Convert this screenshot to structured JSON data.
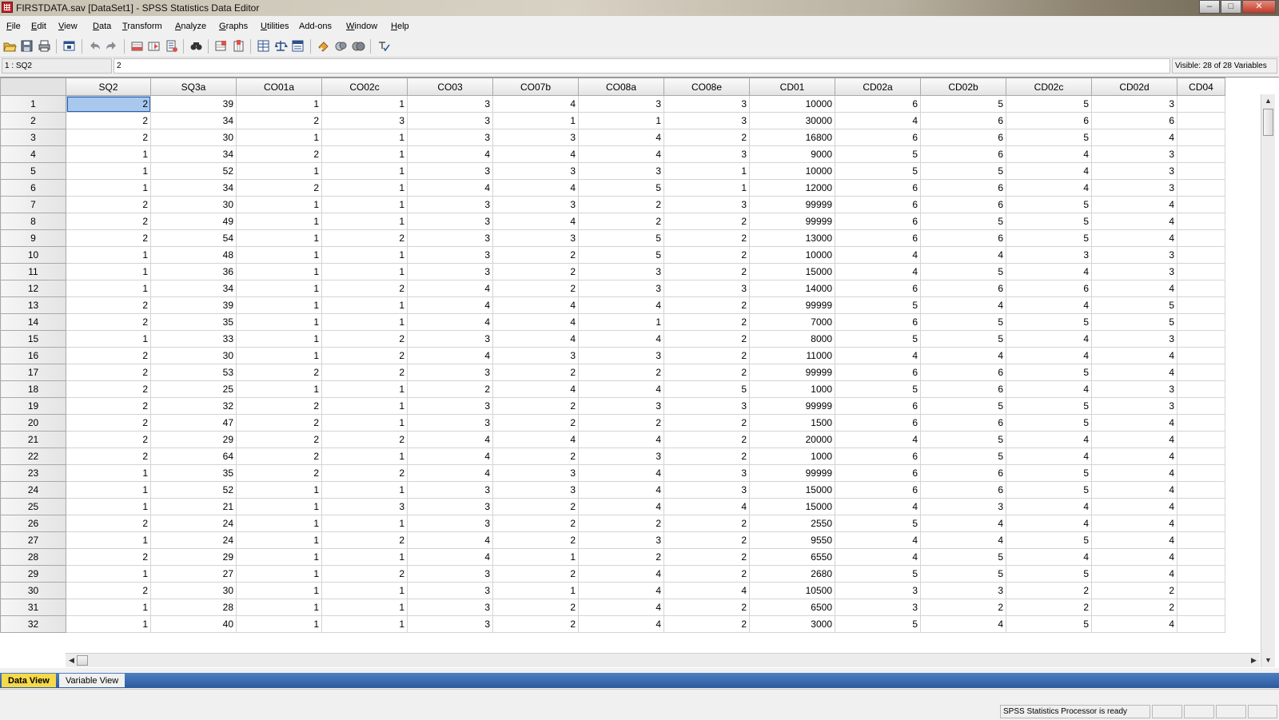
{
  "window": {
    "title": "FIRSTDATA.sav [DataSet1] - SPSS Statistics Data Editor",
    "minimize": "–",
    "maximize": "□",
    "close": "✕"
  },
  "menu": [
    {
      "u": "F",
      "rest": "ile"
    },
    {
      "u": "E",
      "rest": "dit"
    },
    {
      "u": "V",
      "rest": "iew"
    },
    {
      "u": "D",
      "rest": "ata"
    },
    {
      "u": "T",
      "rest": "ransform"
    },
    {
      "u": "A",
      "rest": "nalyze"
    },
    {
      "u": "G",
      "rest": "raphs"
    },
    {
      "u": "U",
      "rest": "tilities"
    },
    {
      "u": "",
      "rest": "Add-ons"
    },
    {
      "u": "W",
      "rest": "indow"
    },
    {
      "u": "H",
      "rest": "elp"
    }
  ],
  "toolbar_icons": [
    "open-icon",
    "save-icon",
    "print-icon",
    "dialog-recall-icon",
    "undo-icon",
    "redo-icon",
    "goto-case-icon",
    "goto-variable-icon",
    "variables-icon",
    "find-icon",
    "insert-cases-icon",
    "insert-variable-icon",
    "split-file-icon",
    "weight-cases-icon",
    "select-cases-icon",
    "value-labels-icon",
    "use-variable-sets-icon",
    "show-all-variables-icon",
    "spell-check-icon"
  ],
  "editor": {
    "cell_ref": "1 : SQ2",
    "cell_value": "2",
    "visible_variables": "Visible: 28 of 28 Variables"
  },
  "columns": [
    "SQ2",
    "SQ3a",
    "CO01a",
    "CO02c",
    "CO03",
    "CO07b",
    "CO08a",
    "CO08e",
    "CD01",
    "CD02a",
    "CD02b",
    "CD02c",
    "CD02d",
    "CD04"
  ],
  "rows": [
    [
      1,
      [
        2,
        39,
        1,
        1,
        3,
        4,
        3,
        3,
        10000,
        6,
        5,
        5,
        3
      ]
    ],
    [
      2,
      [
        2,
        34,
        2,
        3,
        3,
        1,
        1,
        3,
        30000,
        4,
        6,
        6,
        6
      ]
    ],
    [
      3,
      [
        2,
        30,
        1,
        1,
        3,
        3,
        4,
        2,
        16800,
        6,
        6,
        5,
        4
      ]
    ],
    [
      4,
      [
        1,
        34,
        2,
        1,
        4,
        4,
        4,
        3,
        9000,
        5,
        6,
        4,
        3
      ]
    ],
    [
      5,
      [
        1,
        52,
        1,
        1,
        3,
        3,
        3,
        1,
        10000,
        5,
        5,
        4,
        3
      ]
    ],
    [
      6,
      [
        1,
        34,
        2,
        1,
        4,
        4,
        5,
        1,
        12000,
        6,
        6,
        4,
        3
      ]
    ],
    [
      7,
      [
        2,
        30,
        1,
        1,
        3,
        3,
        2,
        3,
        99999,
        6,
        6,
        5,
        4
      ]
    ],
    [
      8,
      [
        2,
        49,
        1,
        1,
        3,
        4,
        2,
        2,
        99999,
        6,
        5,
        5,
        4
      ]
    ],
    [
      9,
      [
        2,
        54,
        1,
        2,
        3,
        3,
        5,
        2,
        13000,
        6,
        6,
        5,
        4
      ]
    ],
    [
      10,
      [
        1,
        48,
        1,
        1,
        3,
        2,
        5,
        2,
        10000,
        4,
        4,
        3,
        3
      ]
    ],
    [
      11,
      [
        1,
        36,
        1,
        1,
        3,
        2,
        3,
        2,
        15000,
        4,
        5,
        4,
        3
      ]
    ],
    [
      12,
      [
        1,
        34,
        1,
        2,
        4,
        2,
        3,
        3,
        14000,
        6,
        6,
        6,
        4
      ]
    ],
    [
      13,
      [
        2,
        39,
        1,
        1,
        4,
        4,
        4,
        2,
        99999,
        5,
        4,
        4,
        5
      ]
    ],
    [
      14,
      [
        2,
        35,
        1,
        1,
        4,
        4,
        1,
        2,
        7000,
        6,
        5,
        5,
        5
      ]
    ],
    [
      15,
      [
        1,
        33,
        1,
        2,
        3,
        4,
        4,
        2,
        8000,
        5,
        5,
        4,
        3
      ]
    ],
    [
      16,
      [
        2,
        30,
        1,
        2,
        4,
        3,
        3,
        2,
        11000,
        4,
        4,
        4,
        4
      ]
    ],
    [
      17,
      [
        2,
        53,
        2,
        2,
        3,
        2,
        2,
        2,
        99999,
        6,
        6,
        5,
        4
      ]
    ],
    [
      18,
      [
        2,
        25,
        1,
        1,
        2,
        4,
        4,
        5,
        1000,
        5,
        6,
        4,
        3
      ]
    ],
    [
      19,
      [
        2,
        32,
        2,
        1,
        3,
        2,
        3,
        3,
        99999,
        6,
        5,
        5,
        3
      ]
    ],
    [
      20,
      [
        2,
        47,
        2,
        1,
        3,
        2,
        2,
        2,
        1500,
        6,
        6,
        5,
        4
      ]
    ],
    [
      21,
      [
        2,
        29,
        2,
        2,
        4,
        4,
        4,
        2,
        20000,
        4,
        5,
        4,
        4
      ]
    ],
    [
      22,
      [
        2,
        64,
        2,
        1,
        4,
        2,
        3,
        2,
        1000,
        6,
        5,
        4,
        4
      ]
    ],
    [
      23,
      [
        1,
        35,
        2,
        2,
        4,
        3,
        4,
        3,
        99999,
        6,
        6,
        5,
        4
      ]
    ],
    [
      24,
      [
        1,
        52,
        1,
        1,
        3,
        3,
        4,
        3,
        15000,
        6,
        6,
        5,
        4
      ]
    ],
    [
      25,
      [
        1,
        21,
        1,
        3,
        3,
        2,
        4,
        4,
        15000,
        4,
        3,
        4,
        4
      ]
    ],
    [
      26,
      [
        2,
        24,
        1,
        1,
        3,
        2,
        2,
        2,
        2550,
        5,
        4,
        4,
        4
      ]
    ],
    [
      27,
      [
        1,
        24,
        1,
        2,
        4,
        2,
        3,
        2,
        9550,
        4,
        4,
        5,
        4
      ]
    ],
    [
      28,
      [
        2,
        29,
        1,
        1,
        4,
        1,
        2,
        2,
        6550,
        4,
        5,
        4,
        4
      ]
    ],
    [
      29,
      [
        1,
        27,
        1,
        2,
        3,
        2,
        4,
        2,
        2680,
        5,
        5,
        5,
        4
      ]
    ],
    [
      30,
      [
        2,
        30,
        1,
        1,
        3,
        1,
        4,
        4,
        10500,
        3,
        3,
        2,
        2
      ]
    ],
    [
      31,
      [
        1,
        28,
        1,
        1,
        3,
        2,
        4,
        2,
        6500,
        3,
        2,
        2,
        2
      ]
    ],
    [
      32,
      [
        1,
        40,
        1,
        1,
        3,
        2,
        4,
        2,
        3000,
        5,
        4,
        5,
        4
      ]
    ]
  ],
  "tabs": {
    "data_view": "Data View",
    "variable_view": "Variable View"
  },
  "status": {
    "processor": "SPSS Statistics  Processor is ready"
  }
}
